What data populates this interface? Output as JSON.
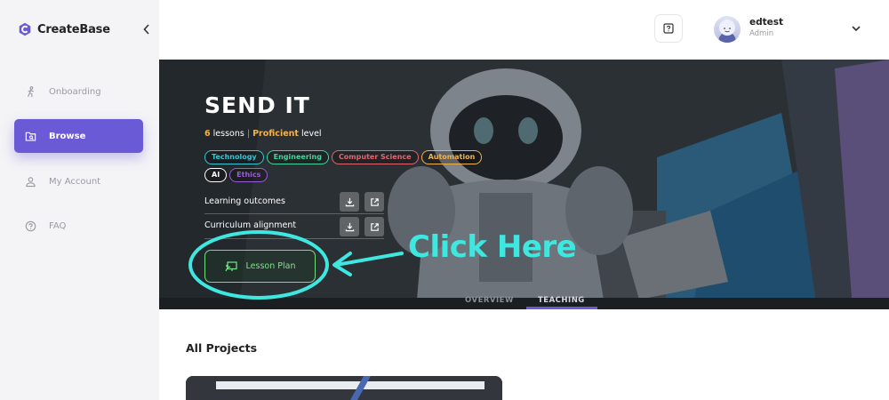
{
  "brand": {
    "name": "CreateBase"
  },
  "sidebar": {
    "items": [
      {
        "label": "Onboarding",
        "icon": "onboarding-icon",
        "active": false
      },
      {
        "label": "Browse",
        "icon": "browse-folder-icon",
        "active": true
      },
      {
        "label": "My Account",
        "icon": "account-icon",
        "active": false
      },
      {
        "label": "FAQ",
        "icon": "question-circle-icon",
        "active": false
      }
    ]
  },
  "header": {
    "help_icon": "help-icon",
    "user": {
      "name": "edtest",
      "role": "Admin"
    }
  },
  "hero": {
    "title": "SEND IT",
    "lessons_count": "6",
    "lessons_word": "lessons",
    "level": "Proficient",
    "level_word": "level",
    "tags": [
      {
        "label": "Technology",
        "color": "#36c5d6"
      },
      {
        "label": "Engineering",
        "color": "#3fd69b"
      },
      {
        "label": "Computer Science",
        "color": "#e3656f"
      },
      {
        "label": "Automation",
        "color": "#f4b24a"
      },
      {
        "label": "AI",
        "color": "#ffffff"
      },
      {
        "label": "Ethics",
        "color": "#9b5ad6"
      }
    ],
    "resources": [
      {
        "label": "Learning outcomes"
      },
      {
        "label": "Curriculum alignment"
      }
    ],
    "lesson_plan_label": "Lesson Plan",
    "tabs": [
      {
        "label": "OVERVIEW",
        "active": false
      },
      {
        "label": "TEACHING",
        "active": true
      }
    ]
  },
  "annotation": {
    "text": "Click Here",
    "color": "#3ee8e0"
  },
  "main": {
    "section_title": "All Projects"
  },
  "colors": {
    "accent": "#6a5ad6",
    "lesson_plan_green": "#6fe07a",
    "level_orange": "#f4b24a"
  }
}
